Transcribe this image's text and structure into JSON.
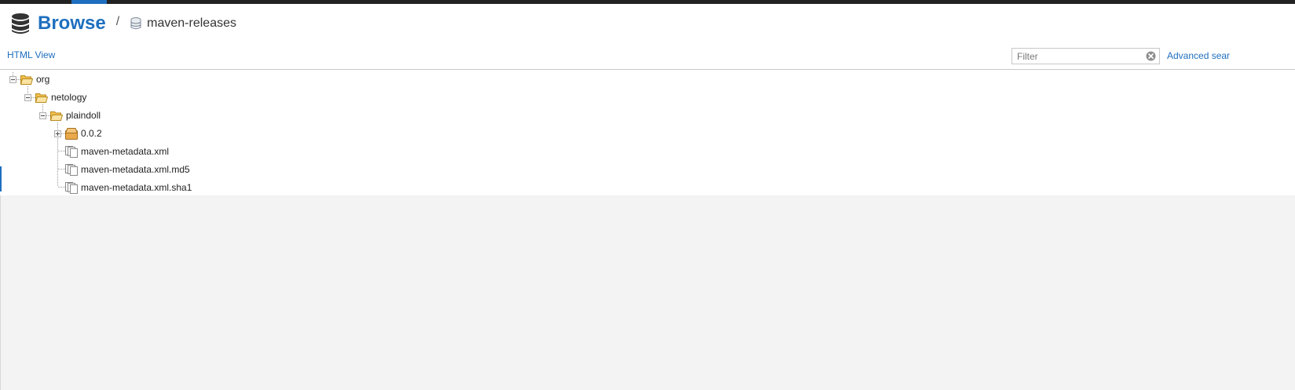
{
  "header": {
    "title": "Browse",
    "separator": "/",
    "repository": "maven-releases"
  },
  "toolbar": {
    "html_view_label": "HTML View",
    "filter_placeholder": "Filter",
    "advanced_search_label": "Advanced sear"
  },
  "tree": {
    "nodes": [
      {
        "label": "org",
        "type": "folder",
        "expanded": true
      },
      {
        "label": "netology",
        "type": "folder",
        "expanded": true
      },
      {
        "label": "plaindoll",
        "type": "folder",
        "expanded": true
      },
      {
        "label": "0.0.2",
        "type": "component",
        "expanded": false
      },
      {
        "label": "maven-metadata.xml",
        "type": "file"
      },
      {
        "label": "maven-metadata.xml.md5",
        "type": "file"
      },
      {
        "label": "maven-metadata.xml.sha1",
        "type": "file"
      }
    ]
  },
  "colors": {
    "accent": "#1e6fbf",
    "topbar": "#222222",
    "folder": "#f2c04d",
    "background": "#f3f3f3"
  }
}
